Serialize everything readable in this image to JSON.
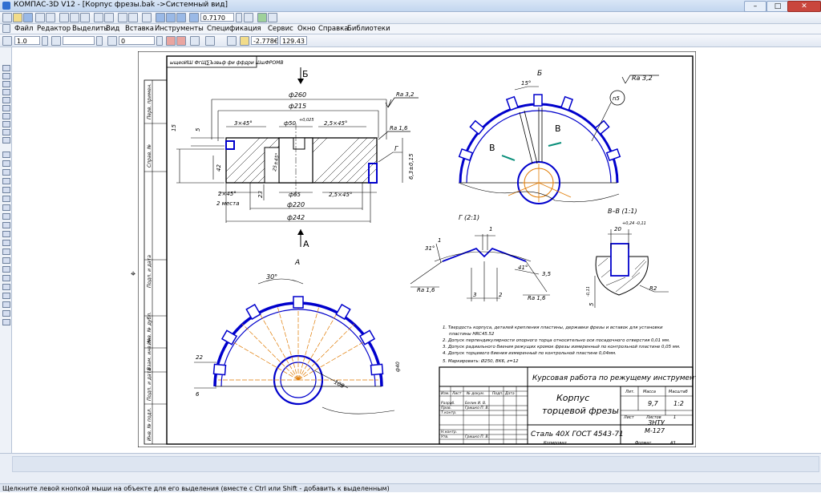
{
  "window": {
    "title": "КОМПАС-3D V12 - [Корпус фрезы.bak ->Системный вид]",
    "controls": {
      "minimize": "–",
      "maximize": "□",
      "close": "✕"
    }
  },
  "toolbar": {
    "zoom_value": "0.7170"
  },
  "menu": {
    "items": [
      "Файл",
      "Редактор",
      "Выделить",
      "Вид",
      "Вставка",
      "Инструменты",
      "Спецификация",
      "Сервис",
      "Окно",
      "Справка",
      "Библиотеки"
    ]
  },
  "properties": {
    "line_scale": "1.0",
    "layer": "0",
    "coord_x": "-2.778€",
    "coord_y": "129.43"
  },
  "drawing": {
    "stamp_top": "ыщеоИШ ФгЩ∑Ъзвьф фи ффдри ШшФРОМВ",
    "side_labels": [
      "Перв. примен.",
      "Справ. №",
      "Подп. и дата",
      "Инв. № дубл.",
      "Взам. инв. №",
      "Подп. и дата",
      "Инв. № подл."
    ],
    "views": {
      "view_b_label": "Б",
      "view_a_label": "А",
      "section_a": "А",
      "section_b": "Б",
      "detail_g": "Г (2:1)",
      "section_vv": "В–В (1:1)",
      "arrow_v1": "В",
      "arrow_v2": "В",
      "leader_g": "Г"
    },
    "dims": {
      "d260": "ф260",
      "d215": "ф215",
      "d50": "ф50",
      "d50_tol": "+0,025",
      "chamfer_3x45": "3×45°",
      "chamfer_25x45": "2,5×45°",
      "d5": "5",
      "d15": "15",
      "d42": "42",
      "d23": "23",
      "chamfer_2x45": "2×45°",
      "two_places": "2 места",
      "d65": "ф65",
      "chamfer_25x45b": "2,5×45°",
      "d220": "ф220",
      "d242": "ф242",
      "r_slot": "25±45°",
      "ra32": "Ra 3,2",
      "ra16": "Ra 1,6",
      "ra32_view": "Ra 3,2",
      "dim_63": "6,3±0,15",
      "angle15": "15°",
      "n5": "n5",
      "angle30": "30°",
      "d22": "22",
      "d6": "6",
      "d108": "108",
      "d_inner": "ф40",
      "g_31": "31°",
      "g_1": "1",
      "g_1b": "1",
      "g_41": "41°",
      "g_35": "3,5",
      "g_3": "3",
      "g_2": "2",
      "g_ra16a": "Ra 1,6",
      "g_ra16b": "Ra 1,6",
      "vv_20": "20",
      "vv_tol": "+0,24 -0,11",
      "vv_r2": "R2",
      "vv_5": "5",
      "vv_tol2": "-0,11"
    },
    "notes": [
      "1. Твердость корпуса, деталей крепления пластины, державки фрезы и вставок для установки",
      "пластины HRC45.52",
      "2. Допуск перпендикулярности опорного торца относительно оси посадочного отверстия 0,01 мм.",
      "3. Допуск радиального биения режущих кромок фрезы измеренный по контрольной пластине 0,05 мм.",
      "4. Допуск торцевого биения измеренный по контрольной пластине 0,04мм.",
      "5. Маркировать: Ø250, ВК6, z=12"
    ],
    "title_block": {
      "course_title": "Курсовая работа по режущему инструменту",
      "part_name_1": "Корпус",
      "part_name_2": "торцевой фрезы",
      "material": "Сталь 40Х ГОСТ 4543-71",
      "lit": "Лит.",
      "mass": "Масса",
      "scale": "Масштаб",
      "mass_val": "9,7",
      "scale_val": "1:2",
      "sheet": "Лист",
      "sheets": "Листов",
      "sheets_val": "1",
      "org_1": "ЗНТУ",
      "org_2": "М-127",
      "col_izm": "Изм.",
      "col_list": "Лист",
      "col_doc": "№ докум.",
      "col_sign": "Подп.",
      "col_date": "Дата",
      "razrab": "Разраб.",
      "prov": "Пров.",
      "tkontr": "Т.контр.",
      "nkontr": "Н.контр.",
      "utv": "Утв.",
      "razrab_name": "Белик И. В.",
      "prov_name": "Гришко П. В.",
      "utv_name": "Гришко П. В.",
      "copied": "Копировал",
      "format": "Формат",
      "format_val": "А3"
    }
  },
  "status": {
    "hint": "Щелкните левой кнопкой мыши на объекте для его выделения (вместе с Ctrl или Shift - добавить к выделенным)"
  },
  "colors": {
    "blue_line": "#0000cc",
    "orange_axis": "#e07a00",
    "teal_mark": "#0a8f7a"
  }
}
